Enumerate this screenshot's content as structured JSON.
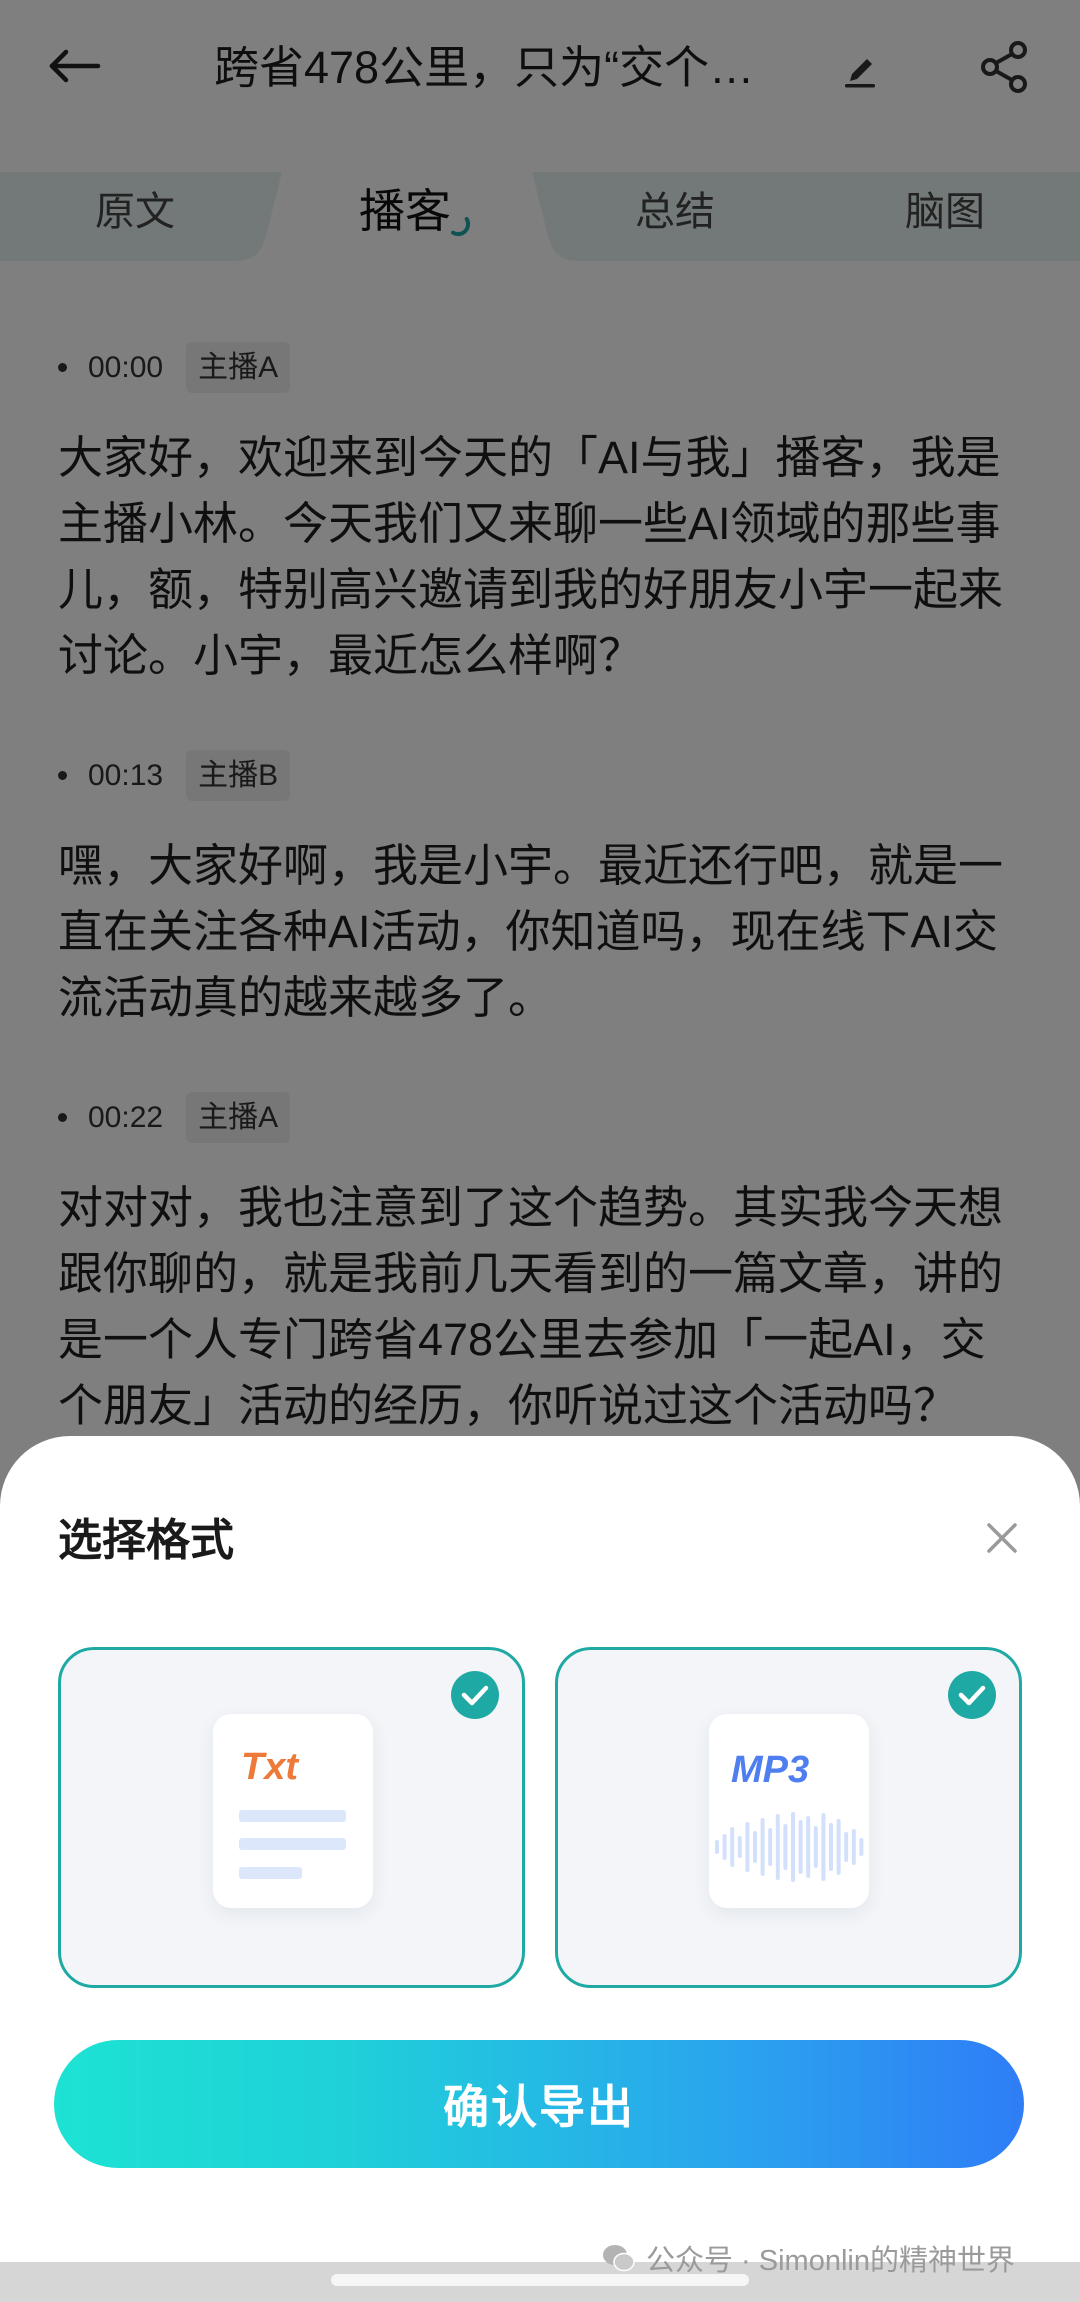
{
  "header": {
    "title": "跨省478公里，只为“交个…",
    "back_icon": "back-arrow-icon",
    "edit_icon": "edit-icon",
    "share_icon": "share-icon"
  },
  "tabs": [
    {
      "label": "原文",
      "active": false
    },
    {
      "label": "播客",
      "active": true,
      "loading": true
    },
    {
      "label": "总结",
      "active": false
    },
    {
      "label": "脑图",
      "active": false
    }
  ],
  "segments": [
    {
      "time": "00:00",
      "speaker": "主播A",
      "lines": [
        "大家好，欢迎来到今天的「AI与我」播客，我是",
        "主播小林。今天我们又来聊一些AI领域的那些事",
        "儿，额，特别高兴邀请到我的好朋友小宇一起来",
        "讨论。小宇，最近怎么样啊？"
      ]
    },
    {
      "time": "00:13",
      "speaker": "主播B",
      "lines": [
        "嘿，大家好啊，我是小宇。最近还行吧，就是一",
        "直在关注各种AI活动，你知道吗，现在线下AI交",
        "流活动真的越来越多了。"
      ]
    },
    {
      "time": "00:22",
      "speaker": "主播A",
      "lines": [
        "对对对，我也注意到了这个趋势。其实我今天想",
        "跟你聊的，就是我前几天看到的一篇文章，讲的",
        "是一个人专门跨省478公里去参加「一起AI，交",
        "个朋友」活动的经历，你听说过这个活动吗？"
      ]
    }
  ],
  "export_sheet": {
    "title": "选择格式",
    "close_icon": "close-icon",
    "formats": [
      {
        "label": "Txt",
        "icon": "txt-file-icon",
        "selected": true
      },
      {
        "label": "MP3",
        "icon": "mp3-audio-icon",
        "selected": true
      }
    ],
    "confirm_label": "确认导出"
  },
  "watermark": {
    "text": "公众号 · Simonlin的精神世界",
    "icon": "wechat-icon"
  },
  "colors": {
    "accent": "#1fa9a4",
    "button_gradient_start": "#1de3d3",
    "button_gradient_end": "#2f7df6",
    "txt_label": "#ee7a3a",
    "mp3_label": "#4f7ef0"
  }
}
